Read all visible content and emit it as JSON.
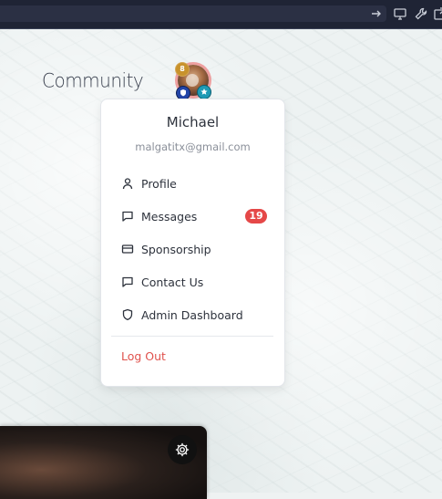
{
  "header": {
    "logo_text": "Community"
  },
  "avatar": {
    "badges": [
      {
        "icon": "coin-badge-icon",
        "label": "8"
      },
      {
        "icon": "shield-badge-icon",
        "label": ""
      },
      {
        "icon": "star-badge-icon",
        "label": ""
      }
    ]
  },
  "user_menu": {
    "name": "Michael",
    "email": "malgatitx@gmail.com",
    "items": [
      {
        "label": "Profile",
        "icon": "user-icon"
      },
      {
        "label": "Messages",
        "icon": "message-icon",
        "badge": "19"
      },
      {
        "label": "Sponsorship",
        "icon": "credit-card-icon"
      },
      {
        "label": "Contact Us",
        "icon": "message-icon"
      },
      {
        "label": "Admin Dashboard",
        "icon": "shield-icon"
      }
    ],
    "logout_label": "Log Out"
  },
  "colors": {
    "badge_red": "#e54848",
    "logout_red": "#e0524d",
    "topbar": "#1f2435"
  }
}
